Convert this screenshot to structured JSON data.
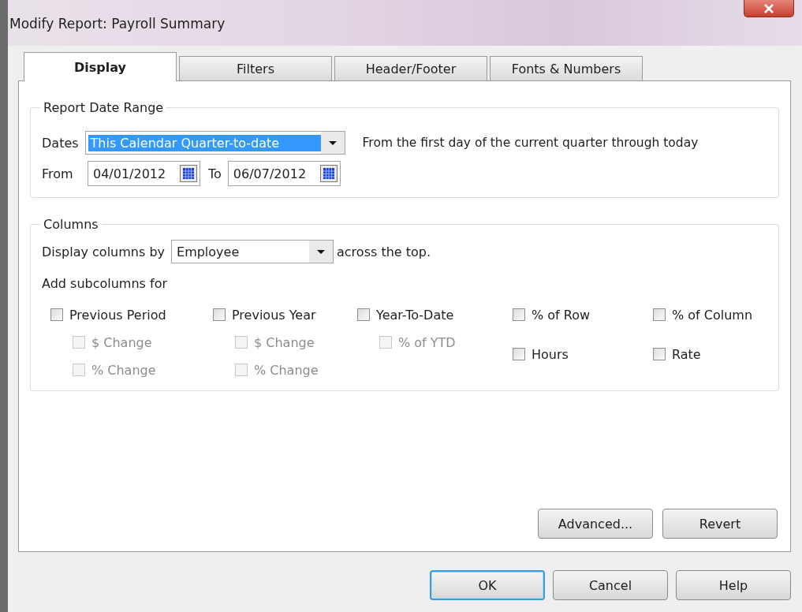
{
  "window": {
    "title": "Modify Report: Payroll Summary"
  },
  "tabs": [
    {
      "label": "Display",
      "selected": true
    },
    {
      "label": "Filters",
      "selected": false
    },
    {
      "label": "Header/Footer",
      "selected": false
    },
    {
      "label": "Fonts & Numbers",
      "selected": false
    }
  ],
  "date_range": {
    "legend": "Report Date Range",
    "dates_label": "Dates",
    "dates_value": "This Calendar Quarter-to-date",
    "description": "From the first day of the current quarter through today",
    "from_label": "From",
    "from_value": "04/01/2012",
    "to_label": "To",
    "to_value": "06/07/2012"
  },
  "columns": {
    "legend": "Columns",
    "display_by_label": "Display columns by",
    "display_by_value": "Employee",
    "display_by_suffix": "across the top.",
    "subcolumns_label": "Add subcolumns for",
    "groups": [
      {
        "items": [
          {
            "kind": "main",
            "label": "Previous Period",
            "checked": false,
            "disabled": false
          },
          {
            "kind": "sub",
            "label": "$ Change",
            "checked": false,
            "disabled": true
          },
          {
            "kind": "sub",
            "label": "% Change",
            "checked": false,
            "disabled": true
          }
        ]
      },
      {
        "items": [
          {
            "kind": "main",
            "label": "Previous Year",
            "checked": false,
            "disabled": false
          },
          {
            "kind": "sub",
            "label": "$ Change",
            "checked": false,
            "disabled": true
          },
          {
            "kind": "sub",
            "label": "% Change",
            "checked": false,
            "disabled": true
          }
        ]
      },
      {
        "items": [
          {
            "kind": "main",
            "label": "Year-To-Date",
            "checked": false,
            "disabled": false
          },
          {
            "kind": "sub",
            "label": "% of YTD",
            "checked": false,
            "disabled": true
          }
        ]
      },
      {
        "items": [
          {
            "kind": "main",
            "label": "% of Row",
            "checked": false,
            "disabled": false
          },
          {
            "kind": "main",
            "label": "Hours",
            "checked": false,
            "disabled": false
          }
        ]
      },
      {
        "items": [
          {
            "kind": "main",
            "label": "% of Column",
            "checked": false,
            "disabled": false
          },
          {
            "kind": "main",
            "label": "Rate",
            "checked": false,
            "disabled": false
          }
        ]
      }
    ]
  },
  "panel_buttons": [
    "Advanced...",
    "Revert"
  ],
  "dialog_buttons": [
    {
      "label": "OK",
      "default": true
    },
    {
      "label": "Cancel",
      "default": false
    },
    {
      "label": "Help",
      "default": false
    }
  ]
}
